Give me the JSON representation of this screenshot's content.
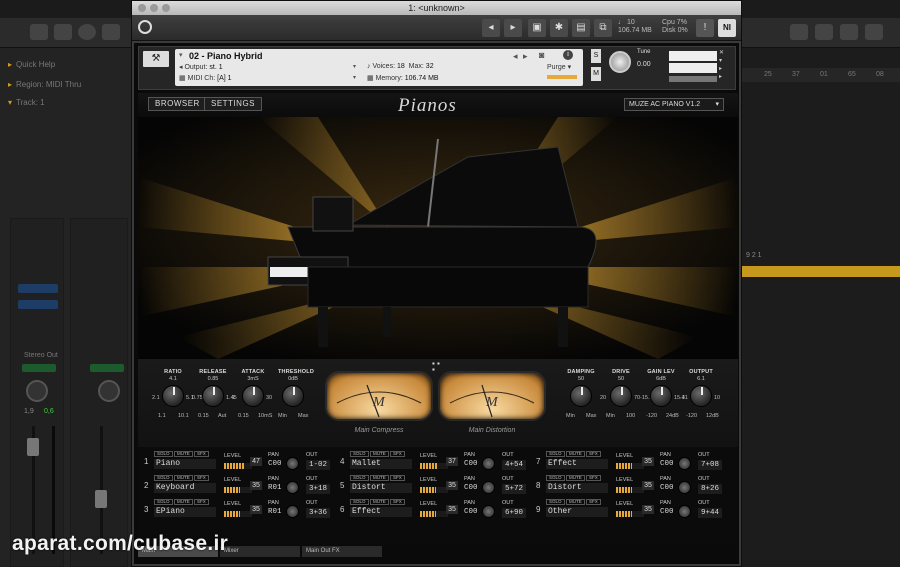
{
  "daw": {
    "inspector": {
      "quick_help": "Quick Help",
      "region": "Region: MIDI Thru",
      "track": "Track: 1",
      "stereo_out": "Stereo Out",
      "read": "Read",
      "value_a": "1,9",
      "value_b": "0,6"
    },
    "ruler": [
      "25",
      "37",
      "01",
      "65",
      "08",
      "29"
    ],
    "ruler2": "9 2 1"
  },
  "window": {
    "title": "1: <unknown>",
    "stats": {
      "voices": "10",
      "memory": "106.74 MB",
      "cpu": "7%",
      "disk": "0%",
      "voices_label": "♩",
      "cpu_label": "Cpu",
      "disk_label": "Disk"
    }
  },
  "instrument_header": {
    "name": "02 - Piano Hybrid",
    "output_label": "Output:",
    "output_value": "st. 1",
    "voices_label": "Voices:",
    "voices_value": "18",
    "max_label": "Max:",
    "max_value": "32",
    "purge_label": "Purge",
    "midi_label": "MIDI Ch:",
    "midi_value": "[A] 1",
    "memory_label": "Memory:",
    "memory_value": "106.74 MB",
    "tune_label": "Tune",
    "tune_value": "0.00",
    "s_label": "S",
    "m_label": "M"
  },
  "topbar": {
    "browser": "BROWSER",
    "settings": "SETTINGS",
    "logo": "Pianos",
    "preset": "MUZE AC PIANO V1.2"
  },
  "controls": {
    "left": [
      {
        "label": "RATIO",
        "value": "4.1",
        "min": "1.1",
        "max": "10.1",
        "side_l": "2.1",
        "side_r": "5.1"
      },
      {
        "label": "RELEASE",
        "value": "0.85",
        "min": "0.15",
        "max": "Aut",
        "side_l": "0.75",
        "side_r": "1.45"
      },
      {
        "label": "ATTACK",
        "value": "3mS",
        "min": "0.15",
        "max": "10mS",
        "side_l": "1",
        "side_r": "30"
      },
      {
        "label": "THRESHOLD",
        "value": "0dB",
        "min": "Min",
        "max": "Max",
        "side_l": "",
        "side_r": ""
      }
    ],
    "right": [
      {
        "label": "DAMPING",
        "value": "50",
        "min": "Min",
        "max": "Max",
        "side_l": "",
        "side_r": ""
      },
      {
        "label": "DRIVE",
        "value": "50",
        "min": "Min",
        "max": "100",
        "side_l": "20",
        "side_r": "70"
      },
      {
        "label": "GAIN LEV",
        "value": "6dB",
        "min": "-120",
        "max": "24dB",
        "side_l": "-15.1",
        "side_r": "15.1"
      },
      {
        "label": "OUTPUT",
        "value": "6.1",
        "min": "-120",
        "max": "12dB",
        "side_l": "-41",
        "side_r": "10"
      }
    ],
    "meter_left": "Main Compress",
    "meter_right": "Main Distortion",
    "meter_scale": [
      "20",
      "10",
      "7",
      "5",
      "3",
      "1",
      "0",
      "1",
      "2",
      "3"
    ]
  },
  "mixer": {
    "solo": "SOLO",
    "mute": "MUTE",
    "sfx": "SFX",
    "level_label": "LEVEL",
    "pan_label": "PAN",
    "out_label": "OUT",
    "channels": [
      {
        "num": "1",
        "name": "Piano",
        "level": "47",
        "pan": "C00",
        "out": "1-02"
      },
      {
        "num": "2",
        "name": "Keyboard",
        "level": "35",
        "pan": "R01",
        "out": "3+18"
      },
      {
        "num": "3",
        "name": "EPiano",
        "level": "35",
        "pan": "R01",
        "out": "3+36"
      },
      {
        "num": "4",
        "name": "Mallet",
        "level": "37",
        "pan": "C00",
        "out": "4+54"
      },
      {
        "num": "5",
        "name": "Distort",
        "level": "35",
        "pan": "C00",
        "out": "5+72"
      },
      {
        "num": "6",
        "name": "Effect",
        "level": "35",
        "pan": "C00",
        "out": "6+90"
      },
      {
        "num": "7",
        "name": "Effect",
        "level": "35",
        "pan": "C00",
        "out": "7+08"
      },
      {
        "num": "8",
        "name": "Distort",
        "level": "35",
        "pan": "C00",
        "out": "8+26"
      },
      {
        "num": "9",
        "name": "Other",
        "level": "35",
        "pan": "C00",
        "out": "9+44"
      }
    ]
  },
  "bottom_tabs": [
    "Main",
    "Mixer",
    "Main Out FX"
  ],
  "watermark": "aparat.com/cubase.ir",
  "colors": {
    "accent": "#f0b43c",
    "region": "#c6981c",
    "meter": "#e8b46a"
  }
}
